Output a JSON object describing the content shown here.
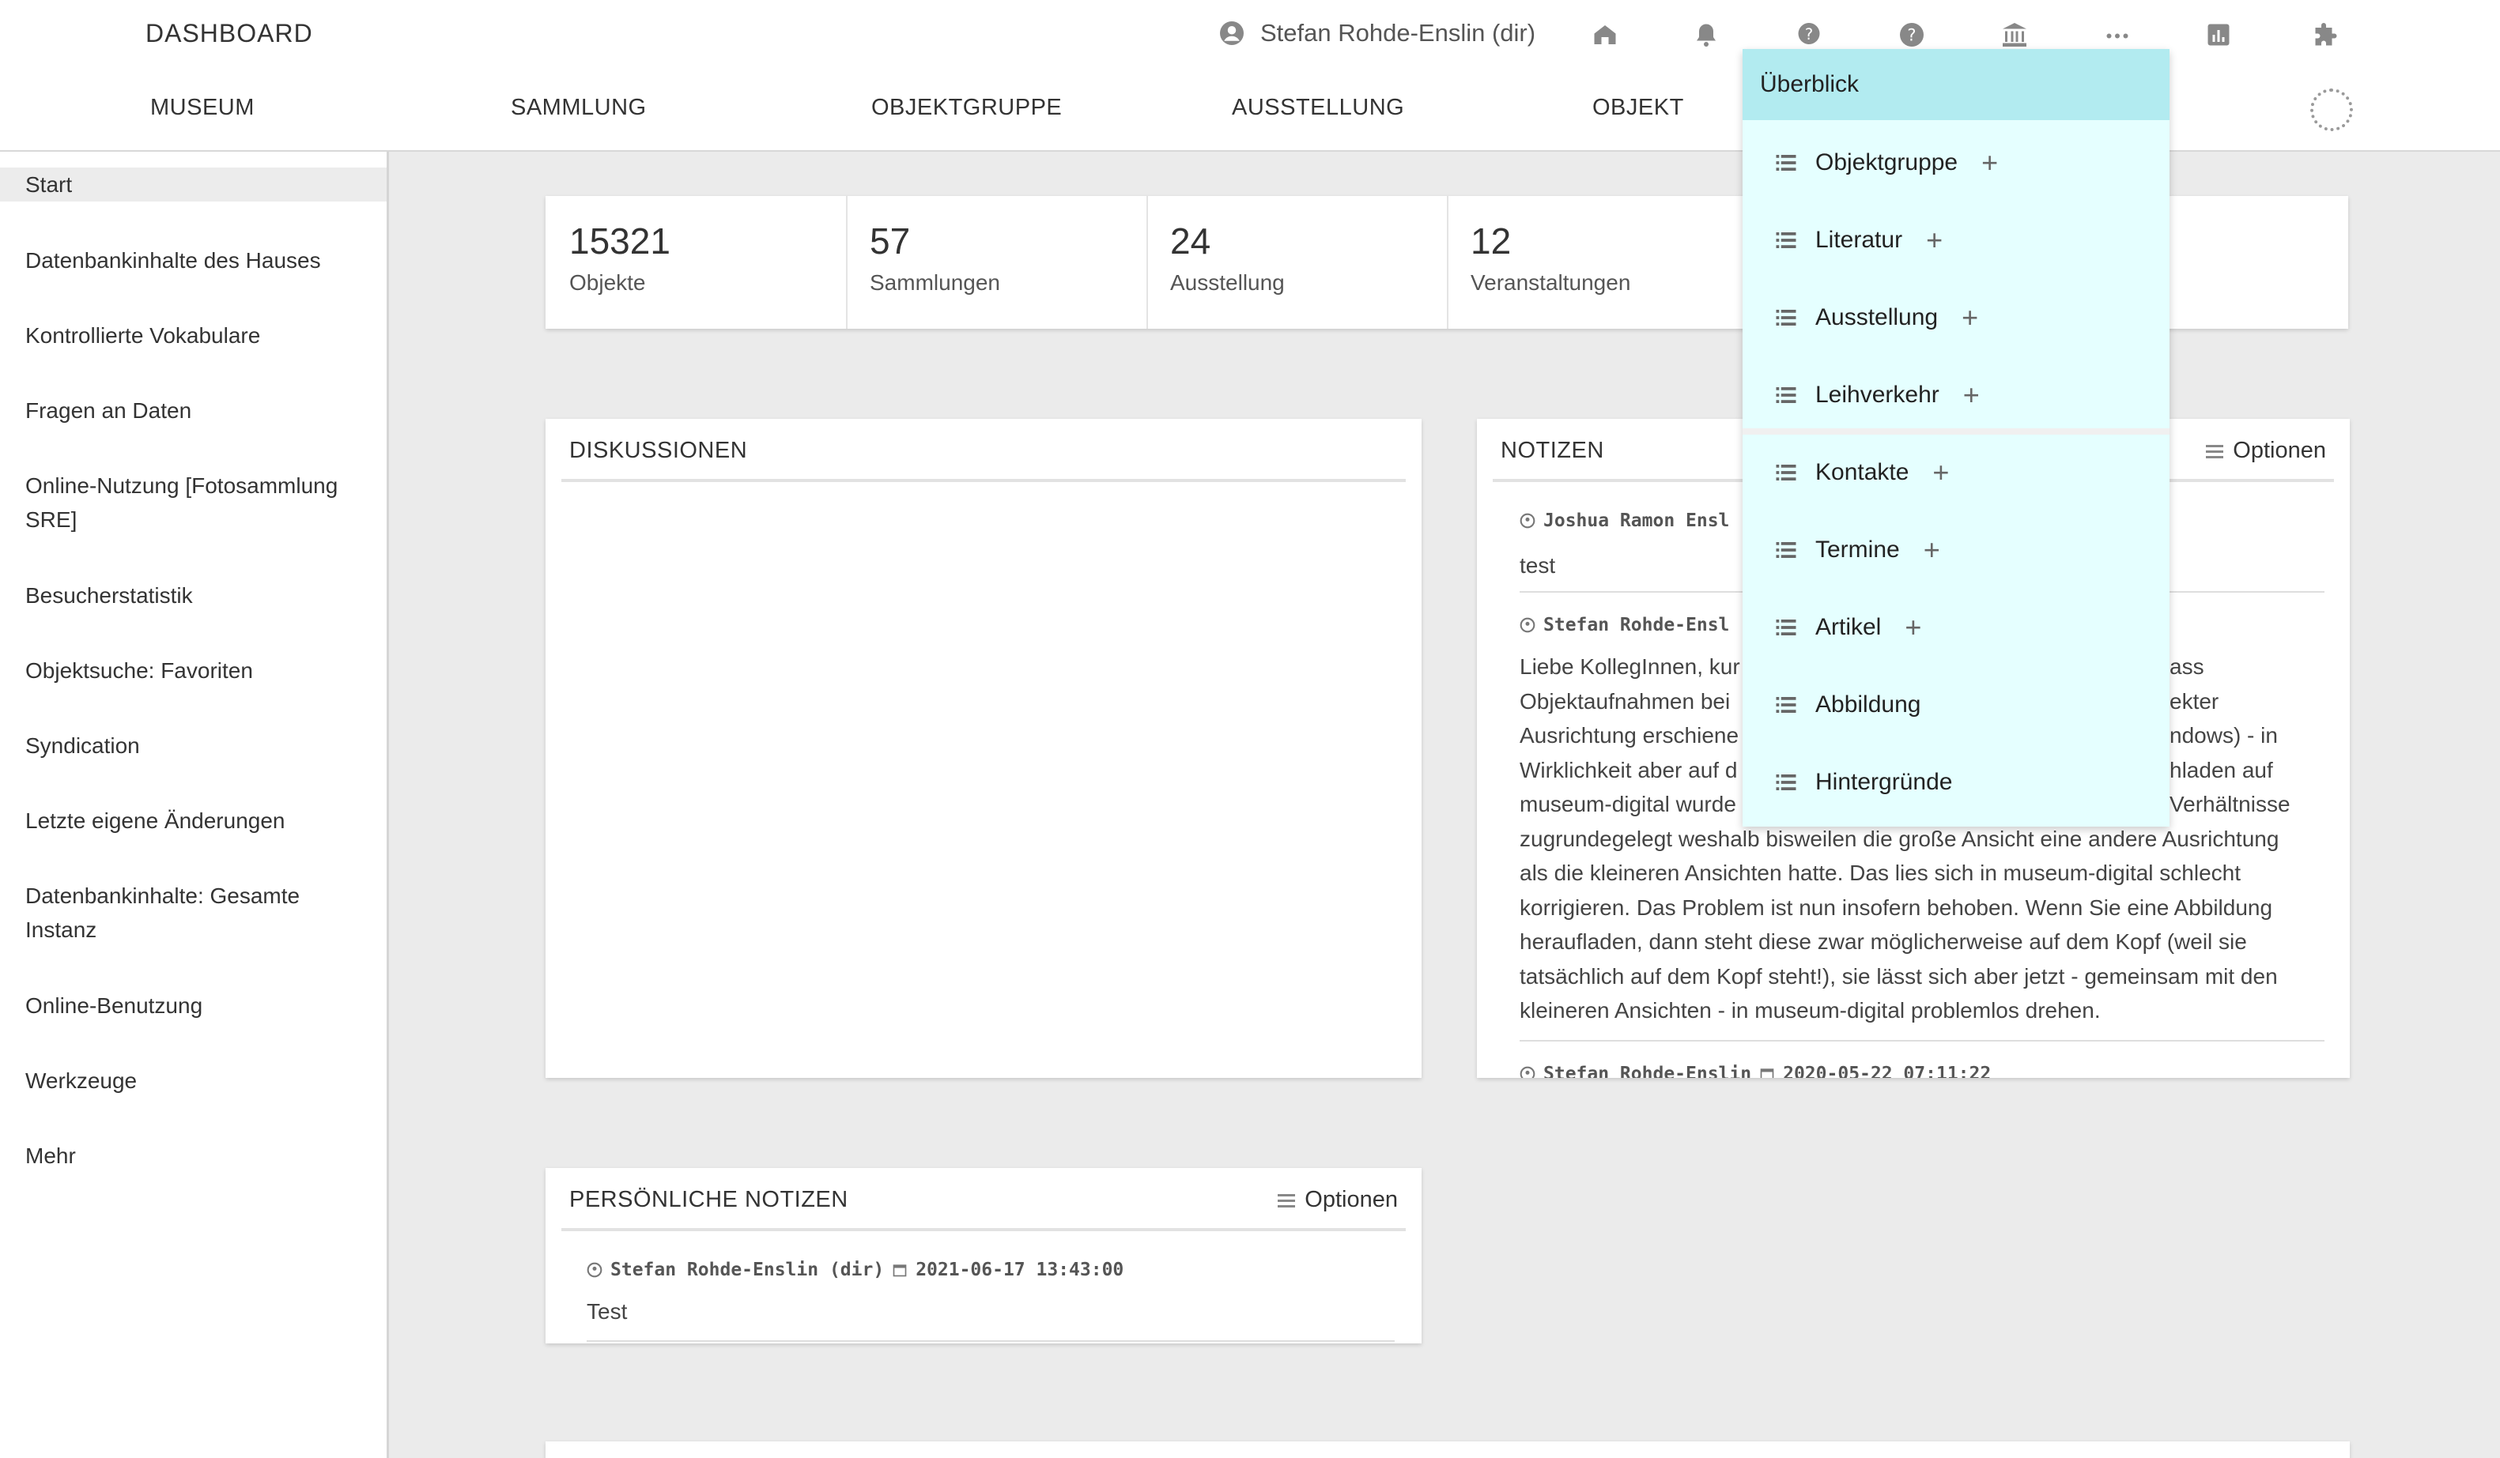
{
  "header": {
    "brand": "DASHBOARD",
    "user": "Stefan Rohde-Enslin (dir)",
    "nav": [
      "MUSEUM",
      "SAMMLUNG",
      "OBJEKTGRUPPE",
      "AUSSTELLUNG",
      "OBJEKT"
    ],
    "icons": [
      "home-icon",
      "bell-icon",
      "help-icon",
      "help-circle-icon",
      "institution-icon",
      "more-icon",
      "chart-icon",
      "puzzle-icon"
    ]
  },
  "sidebar": {
    "items": [
      {
        "label": "Start"
      },
      {
        "label": "Datenbankinhalte des Hauses"
      },
      {
        "label": "Kontrollierte Vokabulare"
      },
      {
        "label": "Fragen an Daten"
      },
      {
        "label": "Online-Nutzung [Fotosammlung SRE]"
      },
      {
        "label": "Besucherstatistik"
      },
      {
        "label": "Objektsuche: Favoriten"
      },
      {
        "label": "Syndication"
      },
      {
        "label": "Letzte eigene Änderungen"
      },
      {
        "label": "Datenbankinhalte: Gesamte Instanz"
      },
      {
        "label": "Online-Benutzung"
      },
      {
        "label": "Werkzeuge"
      },
      {
        "label": "Mehr"
      }
    ]
  },
  "stats": [
    {
      "value": "15321",
      "label": "Objekte"
    },
    {
      "value": "57",
      "label": "Sammlungen"
    },
    {
      "value": "24",
      "label": "Ausstellung"
    },
    {
      "value": "12",
      "label": "Veranstaltungen"
    }
  ],
  "diskussionen": {
    "title": "DISKUSSIONEN"
  },
  "notizen": {
    "title": "NOTIZEN",
    "options": "Optionen",
    "notes": [
      {
        "author": "Joshua Ramon Ensl",
        "text": "test"
      },
      {
        "author": "Stefan Rohde-Ensl",
        "lines": [
          "Liebe KollegInnen, kur",
          "Objektaufnahmen bei",
          "Ausrichtung erschiene",
          "Wirklichkeit aber auf d",
          "museum-digital wurde",
          "zugrundegelegt weshalb bisweilen die große Ansicht eine andere Ausrichtung",
          "als die kleineren Ansichten hatte. Das lies sich in museum-digital schlecht",
          "korrigieren. Das Problem ist nun insofern behoben. Wenn Sie eine Abbildung",
          "heraufladen, dann steht diese zwar möglicherweise auf dem Kopf (weil sie",
          "tatsächlich auf dem Kopf steht!), sie lässt sich aber jetzt - gemeinsam mit den",
          "kleineren Ansichten - in museum-digital problemlos drehen."
        ],
        "right_fragments": [
          "ass",
          "ekter",
          "ndows) - in",
          "hladen auf",
          "Verhältnisse"
        ]
      },
      {
        "author": "Stefan Rohde-Enslin",
        "date": "2020-05-22 07:11:22"
      }
    ]
  },
  "personal": {
    "title": "PERSÖNLICHE NOTIZEN",
    "options": "Optionen",
    "author": "Stefan Rohde-Enslin (dir)",
    "date": "2021-06-17 13:43:00",
    "text": "Test"
  },
  "dropdown": {
    "header": "Überblick",
    "items": [
      {
        "label": "Objektgruppe",
        "plus": "+"
      },
      {
        "label": "Literatur",
        "plus": "+"
      },
      {
        "label": "Ausstellung",
        "plus": "+"
      },
      {
        "label": "Leihverkehr",
        "plus": "+"
      },
      {
        "label": "Kontakte",
        "plus": "+"
      },
      {
        "label": "Termine",
        "plus": "+"
      },
      {
        "label": "Artikel",
        "plus": "+"
      },
      {
        "label": "Abbildung"
      },
      {
        "label": "Hintergründe"
      }
    ]
  },
  "colors": {
    "dropdown_bg": "#e5ffff",
    "dropdown_header": "#b2ebf0",
    "page_bg": "#ebebeb"
  }
}
